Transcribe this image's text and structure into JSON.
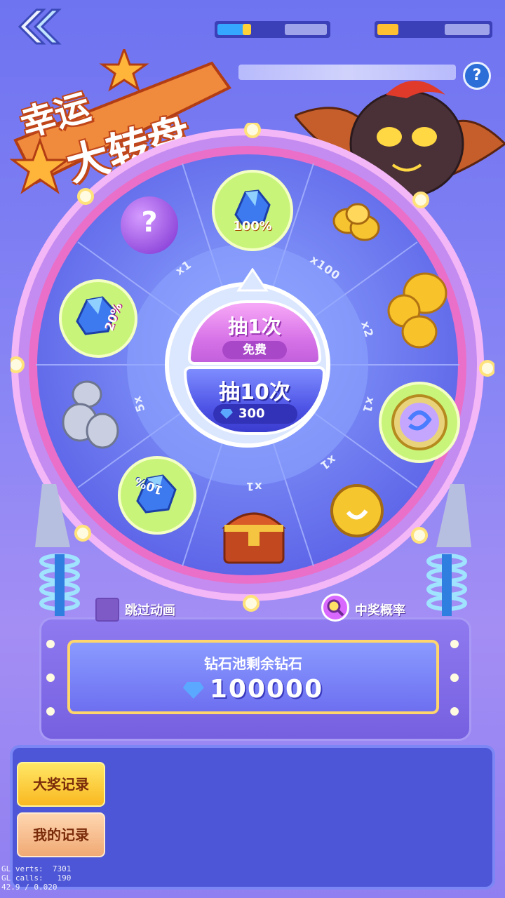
{
  "title": {
    "line1": "幸运",
    "line2": "大转盘"
  },
  "help": {
    "label": "?"
  },
  "wheel": {
    "center": {
      "draw_once": {
        "label": "抽1次",
        "sub": "免费"
      },
      "draw_ten": {
        "label": "抽10次",
        "cost": "300"
      }
    },
    "prizes": [
      {
        "name": "diamond-pile-100",
        "badge": "100%"
      },
      {
        "name": "gold-coins",
        "badge": ""
      },
      {
        "name": "gold-peanut",
        "badge": ""
      },
      {
        "name": "swirl-orb",
        "badge": ""
      },
      {
        "name": "gold-pet-medal",
        "badge": ""
      },
      {
        "name": "treasure-chest",
        "badge": ""
      },
      {
        "name": "diamond-pile-10",
        "badge": "10%"
      },
      {
        "name": "silver-peanut",
        "badge": ""
      },
      {
        "name": "diamond-pile-20",
        "badge": "20%"
      },
      {
        "name": "mystery-orb",
        "badge": "?"
      }
    ],
    "multipliers": [
      "x1",
      "x100",
      "x2",
      "x1",
      "x1",
      "x1",
      "5x"
    ]
  },
  "options": {
    "skip_animation": "跳过动画",
    "win_probability": "中奖概率"
  },
  "pool": {
    "title": "钻石池剩余钻石",
    "value": "100000"
  },
  "records": {
    "grand_prize": "大奖记录",
    "mine": "我的记录"
  },
  "debug": {
    "line1": "GL verts:  7301",
    "line2": "GL calls:   190",
    "line3": "42.9 / 0.020"
  },
  "colors": {
    "gold": "#ffd66b",
    "purple": "#b76ae8",
    "blue": "#4f55e6"
  }
}
